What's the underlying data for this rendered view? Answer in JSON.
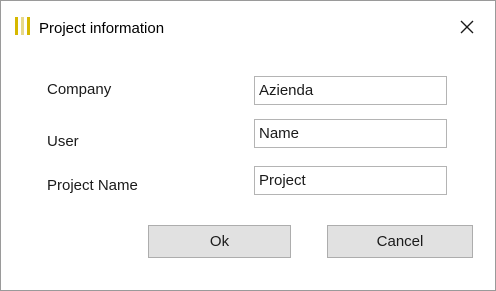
{
  "window": {
    "title": "Project information",
    "icon": "folder-bars-icon",
    "close_glyph": "✕"
  },
  "form": {
    "company_label": "Company",
    "company_value": "Azienda",
    "user_label": "User",
    "user_value": "Name",
    "project_label": "Project Name",
    "project_value": "Project"
  },
  "buttons": {
    "ok_label": "Ok",
    "cancel_label": "Cancel"
  },
  "colors": {
    "icon_bar": "#d6b800",
    "button_face": "#e1e1e1",
    "input_border": "#b4b4b4"
  }
}
